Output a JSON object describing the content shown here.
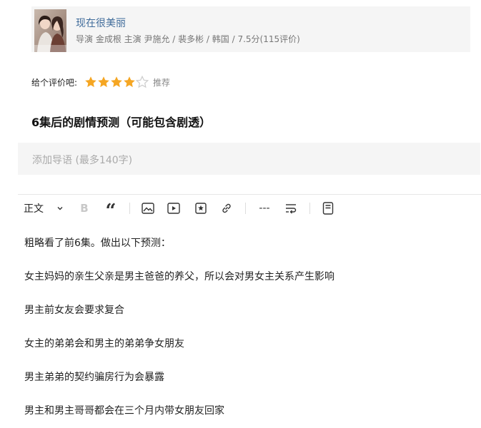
{
  "movie": {
    "title": "现在很美丽",
    "meta": "导演 金成根 主演 尹施允 / 裴多彬 / 韩国 / 7.5分(115评价)"
  },
  "rating": {
    "prompt": "给个评价吧:",
    "stars_filled": 4,
    "stars_total": 5,
    "level_label": "推荐"
  },
  "post": {
    "title": "6集后的剧情预测（可能包含剧透）"
  },
  "summary": {
    "placeholder": "添加导语 (最多140字)"
  },
  "toolbar": {
    "style_label": "正文",
    "bold_label": "B",
    "quote_label": "“",
    "divider_label": "---"
  },
  "body": {
    "paragraphs": [
      "粗略看了前6集。做出以下预测：",
      "女主妈妈的亲生父亲是男主爸爸的养父，所以会对男女主关系产生影响",
      "男主前女友会要求复合",
      "女主的弟弟会和男主的弟弟争女朋友",
      "男主弟弟的契约骗房行为会暴露",
      "男主和男主哥哥都会在三个月内带女朋友回家"
    ]
  },
  "colors": {
    "star": "#f5a623",
    "star_empty": "#cccccc",
    "link": "#3f6b9a",
    "card_bg": "#f5f5f5"
  }
}
